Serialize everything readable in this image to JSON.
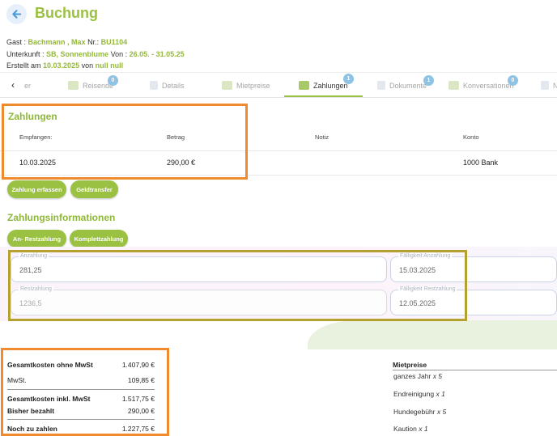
{
  "header": {
    "title": "Buchung"
  },
  "info": {
    "gast_label": "Gast :",
    "gast_name": "Bachmann , Max",
    "nr_label": "Nr.:",
    "nr_value": "BU1104",
    "unterkunft_label": "Unterkunft :",
    "unterkunft_value": "SB, Sonnenblume",
    "von_label": "Von :",
    "von_value": "26.05. - 31.05.25",
    "erstellt_label": "Erstellt am",
    "erstellt_date": "10.03.2025",
    "von2_label": "von",
    "von2_value": "null null"
  },
  "tabs": [
    {
      "label": "er"
    },
    {
      "label": "Reisende",
      "badge": "0"
    },
    {
      "label": "Details"
    },
    {
      "label": "Mietpreise"
    },
    {
      "label": "Zahlungen",
      "badge": "1"
    },
    {
      "label": "Dokumente",
      "badge": "1"
    },
    {
      "label": "Konversationen",
      "badge": "0"
    },
    {
      "label": "N",
      "badge": ""
    }
  ],
  "zahlungen": {
    "title": "Zahlungen",
    "columns": [
      "Empfangen:",
      "Betrag",
      "Notiz",
      "Konto"
    ],
    "rows": [
      {
        "empfangen": "10.03.2025",
        "betrag": "290,00 €",
        "notiz": "",
        "konto": "1000 Bank"
      }
    ],
    "buttons": {
      "erfassen": "Zahlung erfassen",
      "geldtransfer": "Geldtransfer"
    }
  },
  "zahlungsinfo": {
    "title": "Zahlungsinformationen",
    "buttons": {
      "an_restzahlung": "An- Restzahlung",
      "komplettzahlung": "Komplettzahlung"
    },
    "fields": {
      "anzahlung": {
        "label": "Anzahlung",
        "value": "281,25"
      },
      "faelligkeit_anzahlung": {
        "label": "Fälligkeit Anzahlung",
        "value": "15.03.2025"
      },
      "restzahlung": {
        "label": "Restzahlung",
        "value": "1236,5"
      },
      "faelligkeit_restzahlung": {
        "label": "Fälligkeit Restzahlung",
        "value": "12.05.2025"
      }
    }
  },
  "summary": {
    "gesamt_ohne_label": "Gesamtkosten ohne MwSt",
    "gesamt_ohne_value": "1.407,90 €",
    "mwst_label": "MwSt.",
    "mwst_value": "109,85 €",
    "gesamt_inkl_label": "Gesamtkosten inkl. MwSt",
    "gesamt_inkl_value": "1.517,75 €",
    "bezahlt_label": "Bisher bezahlt",
    "bezahlt_value": "290,00 €",
    "noch_label": "Noch zu zahlen",
    "noch_value": "1.227,75 €"
  },
  "mietpreise": {
    "title": "Mietpreise",
    "items": [
      {
        "name": "ganzes Jahr",
        "qty": "x 5"
      },
      {
        "name": "Endreinigung",
        "qty": "x 1"
      },
      {
        "name": "Hundegebühr",
        "qty": "x 5"
      },
      {
        "name": "Kaution",
        "qty": "x 1"
      }
    ]
  },
  "colors": {
    "accent": "#9ac142",
    "highlight_orange": "#f08a2e",
    "highlight_olive": "#b5a22e",
    "badge": "#8ec3e6"
  },
  "icons": {
    "back": "arrow-left-icon",
    "reisende": "people-icon",
    "details": "document-icon",
    "mietpreise": "price-list-icon",
    "zahlungen": "money-icon",
    "dokumente": "file-icon",
    "konversationen": "chat-icon",
    "tab_left": "chevron-left-icon"
  }
}
